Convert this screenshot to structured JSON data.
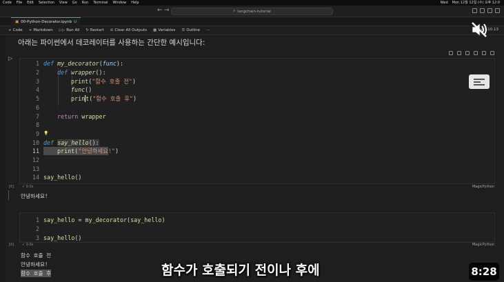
{
  "menubar": {
    "items": [
      "Code",
      "File",
      "Edit",
      "Selection",
      "View",
      "Go",
      "Run",
      "Terminal",
      "Window",
      "Help"
    ],
    "right": [
      "Wed",
      "Mon 12월 12일 (수) 오후 12:0"
    ]
  },
  "window": {
    "search": "langchain-tutorial"
  },
  "tab": {
    "label": "00-Python-Decorator.ipynb",
    "modified": "U"
  },
  "toolbar": {
    "code": "Code",
    "markdown": "Markdown",
    "run_all": "Run All",
    "restart": "Restart",
    "clear_outputs": "Clear All Outputs",
    "variables": "Variables",
    "outline": "Outline",
    "more": "···",
    "kernel": "py-3.10.13"
  },
  "markdown": {
    "text": "아래는 파이썬에서 데코레이터를 사용하는 간단한 예시입니다:"
  },
  "cell1": {
    "exec_index": "[6]",
    "duration": "0.0s",
    "language": "MagicPython",
    "lines": [
      "1",
      "2",
      "3",
      "4",
      "5",
      "6",
      "7",
      "8",
      "9",
      "10",
      "11",
      "12",
      "13",
      "14"
    ],
    "code": {
      "l1_def": "def",
      "l1_name": " my_decorator",
      "l1_paren": "(",
      "l1_param": "func",
      "l1_end": "):",
      "l2_def": "def",
      "l2_name": " wrapper",
      "l2_end": "():",
      "l3_fn": "print",
      "l3_open": "(",
      "l3_str": "\"함수 호출 전\"",
      "l3_close": ")",
      "l4_call": "func",
      "l4_end": "()",
      "l5_fn": "prin",
      "l5_cursor": "t",
      "l5_open": "(",
      "l5_str": "\"함수 호출 후\"",
      "l5_close": ")",
      "l7_ret": "return",
      "l7_val": " wrapper",
      "l9_bulb": "💡",
      "l10_def": "def",
      "l10_sp": " ",
      "l10_name": "say_hello",
      "l10_end": "():",
      "l11_fn": "print",
      "l11_open": "(",
      "l11_str": "\"안녕하세요",
      "l11_str2": "!\"",
      "l11_close": ")",
      "l14_fn": "say_hello",
      "l14_end": "()"
    },
    "output": "안녕하세요!"
  },
  "cell2": {
    "exec_index": "[8]",
    "duration": "0.0s",
    "language": "MagicPython",
    "lines": [
      "1",
      "2",
      "3"
    ],
    "code": {
      "l1_a": "say_hello",
      "l1_eq": " = ",
      "l1_fn": "my_decorator",
      "l1_open": "(",
      "l1_arg": "say_hello",
      "l1_close": ")",
      "l3_fn": "say_hello",
      "l3_end": "()"
    },
    "output": [
      "함수 호출 전",
      "안녕하세요!",
      "함수 호출 후"
    ]
  },
  "overlay": {
    "subtitle": "함수가 호출되기 전이나 후에",
    "timer": "8:28"
  },
  "colors": {
    "keyword": "#569cd6",
    "function": "#dcdcaa",
    "string": "#ce9178",
    "control": "#c586c0",
    "accent": "#3794ff"
  }
}
